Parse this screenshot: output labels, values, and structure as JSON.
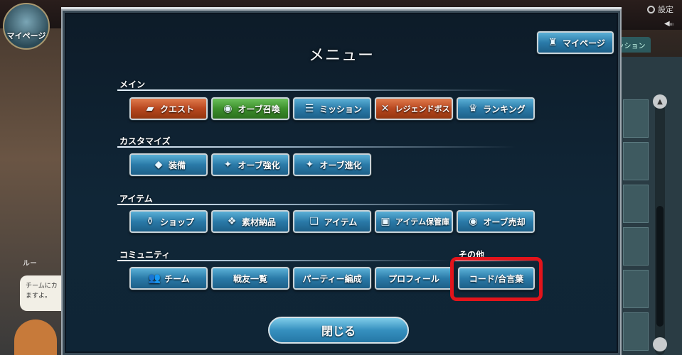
{
  "background": {
    "mypage_badge": "マイページ",
    "settings_label": "設定",
    "sound_label": "◀ᵢᵢᵢ",
    "side_tab": "ッション",
    "npc_name": "ルー",
    "chat_text_line1": "チームにカ",
    "chat_text_line2": "ますよ。"
  },
  "menu": {
    "title": "メニュー",
    "mypage_button": "マイページ",
    "close_button": "閉じる",
    "sections": {
      "main": {
        "label": "メイン",
        "items": [
          "クエスト",
          "オーブ召喚",
          "ミッション",
          "レジェンドボス",
          "ランキング"
        ]
      },
      "customize": {
        "label": "カスタマイズ",
        "items": [
          "装備",
          "オーブ強化",
          "オーブ進化"
        ]
      },
      "items": {
        "label": "アイテム",
        "items": [
          "ショップ",
          "素材納品",
          "アイテム",
          "アイテム保管庫",
          "オーブ売却"
        ]
      },
      "community": {
        "label": "コミュニティ",
        "items": [
          "チーム",
          "戦友一覧",
          "パーティー編成",
          "プロフィール"
        ]
      },
      "other": {
        "label": "その他",
        "items": [
          "コード/合言葉"
        ]
      }
    }
  },
  "colors": {
    "highlight": "#e3141b",
    "button_blue": "#2a7aa8",
    "button_orange": "#b8471f",
    "button_green": "#3d8f2c"
  },
  "icons": {
    "quest": "book-icon",
    "orb_summon": "orb-icon",
    "mission": "checklist-icon",
    "legend_boss": "crossed-swords-icon",
    "ranking": "crown-icon",
    "equip": "shield-icon",
    "orb_enhance": "orb-sparkle-icon",
    "orb_evolve": "orb-sparkle-icon",
    "shop": "bottles-icon",
    "material": "materials-icon",
    "item": "items-icon",
    "storage": "chest-icon",
    "orb_sell": "orb-icon",
    "team": "people-icon"
  }
}
